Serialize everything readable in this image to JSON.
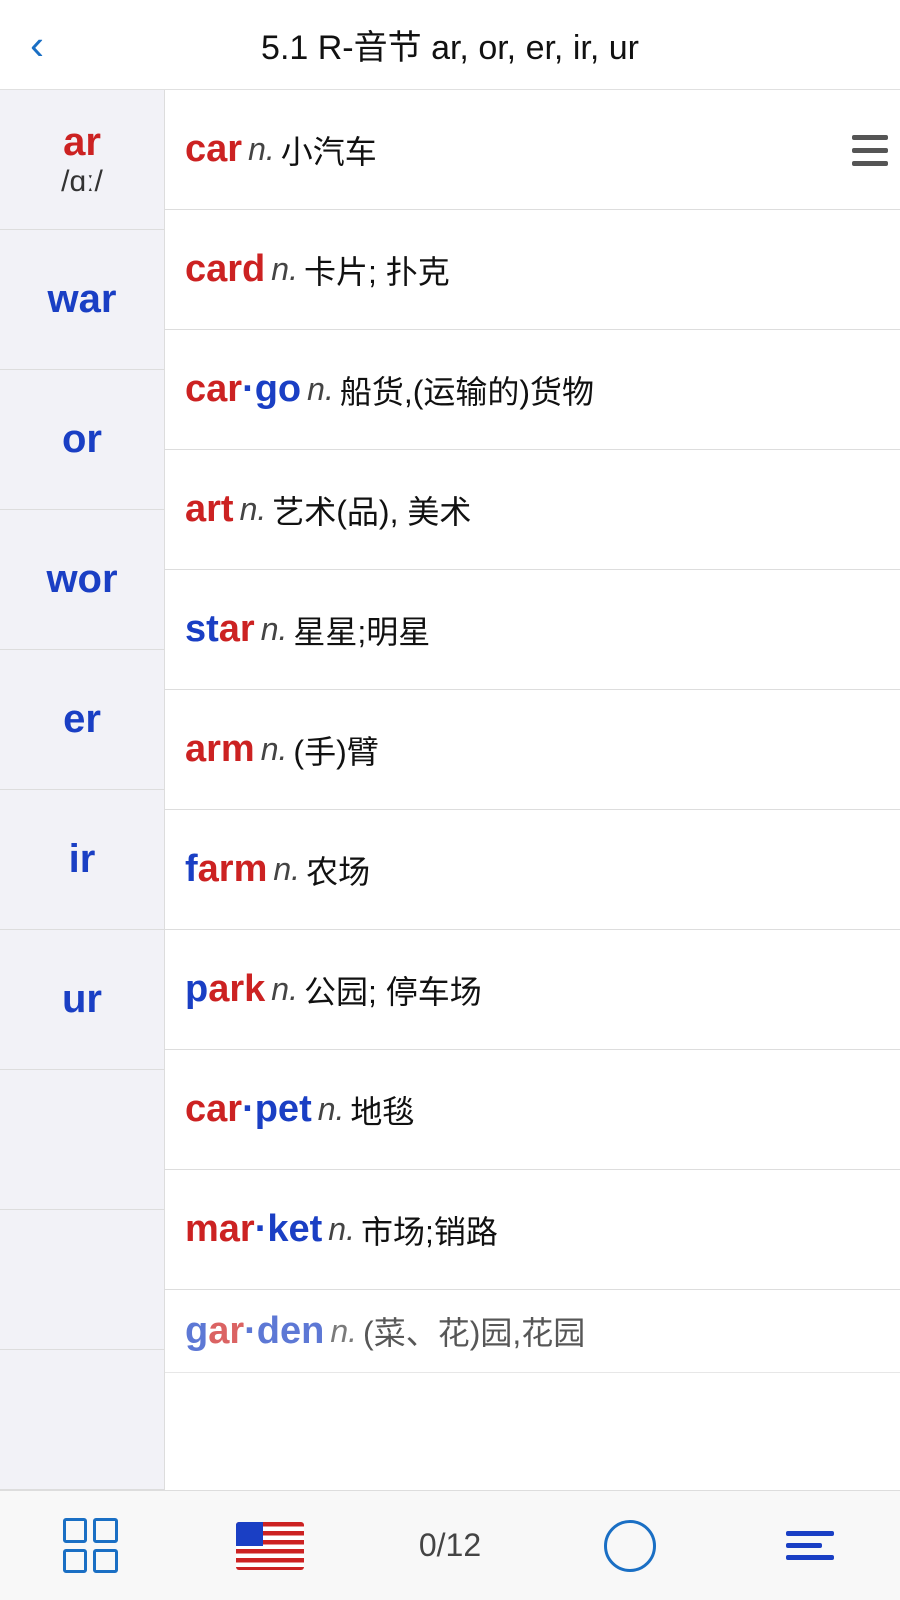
{
  "header": {
    "title": "5.1 R-音节 ar, or, er, ir, ur",
    "back_label": "‹"
  },
  "sidebar": {
    "items": [
      {
        "id": "ar",
        "label": "ar",
        "phonetic": "/ɑː/",
        "color": "red",
        "has_phonetic": true
      },
      {
        "id": "war",
        "label": "war",
        "color": "blue",
        "has_phonetic": false
      },
      {
        "id": "or",
        "label": "or",
        "color": "blue",
        "has_phonetic": false
      },
      {
        "id": "wor",
        "label": "wor",
        "color": "blue",
        "has_phonetic": false
      },
      {
        "id": "er",
        "label": "er",
        "color": "blue",
        "has_phonetic": false
      },
      {
        "id": "ir",
        "label": "ir",
        "color": "blue",
        "has_phonetic": false
      },
      {
        "id": "ur",
        "label": "ur",
        "color": "blue",
        "has_phonetic": false
      },
      {
        "id": "blank1",
        "label": "",
        "color": "blue",
        "has_phonetic": false
      },
      {
        "id": "blank2",
        "label": "",
        "color": "blue",
        "has_phonetic": false
      },
      {
        "id": "blank3",
        "label": "",
        "color": "blue",
        "has_phonetic": false
      }
    ]
  },
  "words": [
    {
      "id": "car",
      "prefix": "car",
      "prefix_color": "red",
      "suffix": "",
      "pos": "n.",
      "definition": "小汽车"
    },
    {
      "id": "card",
      "prefix": "card",
      "prefix_color": "red",
      "suffix": "",
      "pos": "n.",
      "definition": "卡片; 扑克"
    },
    {
      "id": "cargo",
      "prefix": "car",
      "prefix_color": "red",
      "suffix": "·go",
      "pos": "n.",
      "definition": "船货,(运输的)货物"
    },
    {
      "id": "art",
      "prefix": "art",
      "prefix_color": "red",
      "suffix": "",
      "pos": "n.",
      "definition": "艺术(品), 美术"
    },
    {
      "id": "star",
      "prefix": "st",
      "prefix_color": "blue",
      "middle": "ar",
      "middle_color": "red",
      "suffix": "",
      "pos": "n.",
      "definition": "星星;明星"
    },
    {
      "id": "arm",
      "prefix": "arm",
      "prefix_color": "red",
      "suffix": "",
      "pos": "n.",
      "definition": "(手)臂"
    },
    {
      "id": "farm",
      "prefix": "f",
      "prefix_color": "blue",
      "middle": "arm",
      "middle_color": "red",
      "suffix": "",
      "pos": "n.",
      "definition": "农场"
    },
    {
      "id": "park",
      "prefix": "p",
      "prefix_color": "blue",
      "middle": "ark",
      "middle_color": "red",
      "suffix": "",
      "pos": "n.",
      "definition": "公园; 停车场"
    },
    {
      "id": "carpet",
      "prefix": "car",
      "prefix_color": "red",
      "suffix": "·pet",
      "pos": "n.",
      "definition": "地毯"
    },
    {
      "id": "market",
      "prefix": "mar",
      "prefix_color": "red",
      "suffix": "·ket",
      "pos": "n.",
      "definition": "市场;销路"
    },
    {
      "id": "garden",
      "prefix": "g",
      "prefix_color": "blue",
      "middle": "ar",
      "middle_color": "red",
      "suffix": "·den",
      "pos": "n.",
      "definition": "(菜、花)园,花园"
    }
  ],
  "bottom_nav": {
    "count": "0/12"
  }
}
